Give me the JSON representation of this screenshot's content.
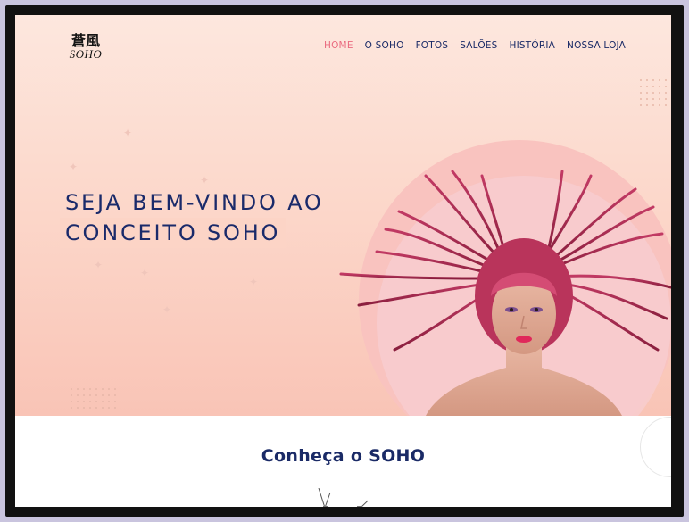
{
  "header": {
    "logo": {
      "glyphs": "蒼風",
      "text": "SOHO"
    },
    "nav": [
      {
        "label": "HOME",
        "active": true
      },
      {
        "label": "O SOHO",
        "active": false
      },
      {
        "label": "FOTOS",
        "active": false
      },
      {
        "label": "SALÕES",
        "active": false
      },
      {
        "label": "HISTÓRIA",
        "active": false
      },
      {
        "label": "NOSSA LOJA",
        "active": false
      }
    ]
  },
  "hero": {
    "headline_line1": "SEJA BEM-VINDO AO",
    "headline_line2": "CONCEITO SOHO",
    "image": "woman-with-flying-pink-hair"
  },
  "section": {
    "title": "Conheça o SOHO"
  },
  "colors": {
    "navy": "#1a2a66",
    "accent_pink": "#ea6b7f",
    "hero_bg": "#fcd8cb",
    "frame": "#111111",
    "outer_bg": "#c9c4de"
  }
}
